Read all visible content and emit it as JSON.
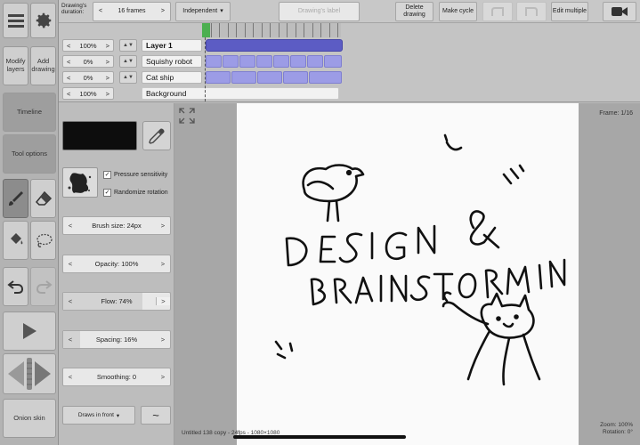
{
  "left_toolbar": {
    "modify_layers": "Modify layers",
    "add_drawing": "Add drawing",
    "timeline": "Timeline",
    "tool_options": "Tool options",
    "onion_skin": "Onion skin"
  },
  "topbar": {
    "duration_label": "Drawing's duration:",
    "duration_value": "16 frames",
    "mode_value": "Independent",
    "drawing_label_placeholder": "Drawing's label",
    "delete_drawing": "Delete drawing",
    "make_cycle": "Make cycle",
    "edit_multiple": "Edit multiple"
  },
  "layers": [
    {
      "opacity": "100%",
      "name": "Layer 1",
      "bold": true
    },
    {
      "opacity": "0%",
      "name": "Squishy robot",
      "bold": false
    },
    {
      "opacity": "0%",
      "name": "Cat ship",
      "bold": false
    },
    {
      "opacity": "100%",
      "name": "Background",
      "bold": false
    }
  ],
  "tool_options": {
    "pressure_sensitivity": "Pressure sensitivity",
    "randomize_rotation": "Randomize rotation",
    "brush_size": "Brush size: 24px",
    "opacity": "Opacity: 100%",
    "flow": "Flow: 74%",
    "spacing": "Spacing: 16%",
    "smoothing": "Smoothing: 0",
    "draw_mode": "Draws in front",
    "curve_symbol": "~",
    "flow_level": 0.74,
    "spacing_level": 0.16
  },
  "canvas": {
    "frame": "Frame: 1/16",
    "zoom": "Zoom: 100%",
    "rotation": "Rotation: 0°",
    "file_info": "Untitled 138 copy - 24fps - 1080×1080",
    "drawing_text": "Design & Brainstorming"
  },
  "colors": {
    "brush_color": "#0d0d0d",
    "layer_active": "#5c5cc4",
    "layer_cell": "#9c9ce6"
  }
}
